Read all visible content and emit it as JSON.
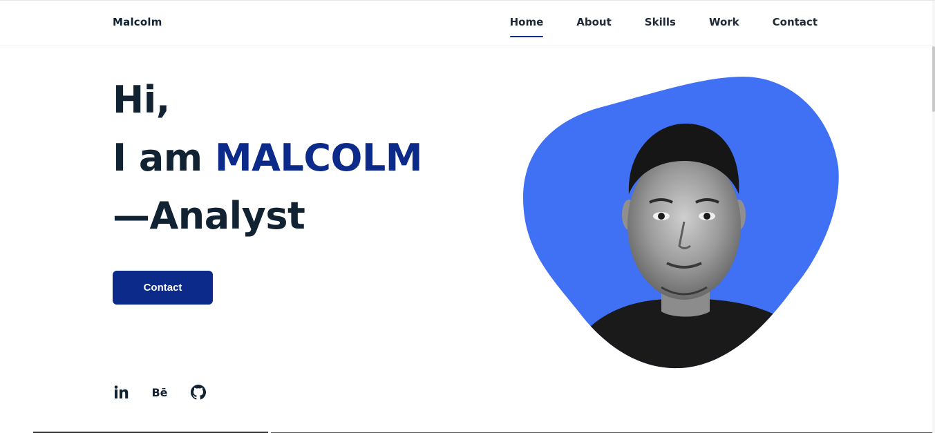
{
  "header": {
    "logo": "Malcolm",
    "nav": [
      {
        "label": "Home",
        "active": true
      },
      {
        "label": "About",
        "active": false
      },
      {
        "label": "Skills",
        "active": false
      },
      {
        "label": "Work",
        "active": false
      },
      {
        "label": "Contact",
        "active": false
      }
    ]
  },
  "hero": {
    "line1": "Hi,",
    "line2_prefix": "I am ",
    "line2_name": "MALCOLM",
    "line3": "—Analyst",
    "cta_label": "Contact"
  },
  "social": {
    "items": [
      {
        "icon": "linkedin-icon",
        "text": "in"
      },
      {
        "icon": "behance-icon",
        "text": "Bē"
      },
      {
        "icon": "github-icon"
      }
    ]
  },
  "colors": {
    "accent": "#0b2a8a",
    "blob": "#4070f4",
    "text": "#112233"
  }
}
